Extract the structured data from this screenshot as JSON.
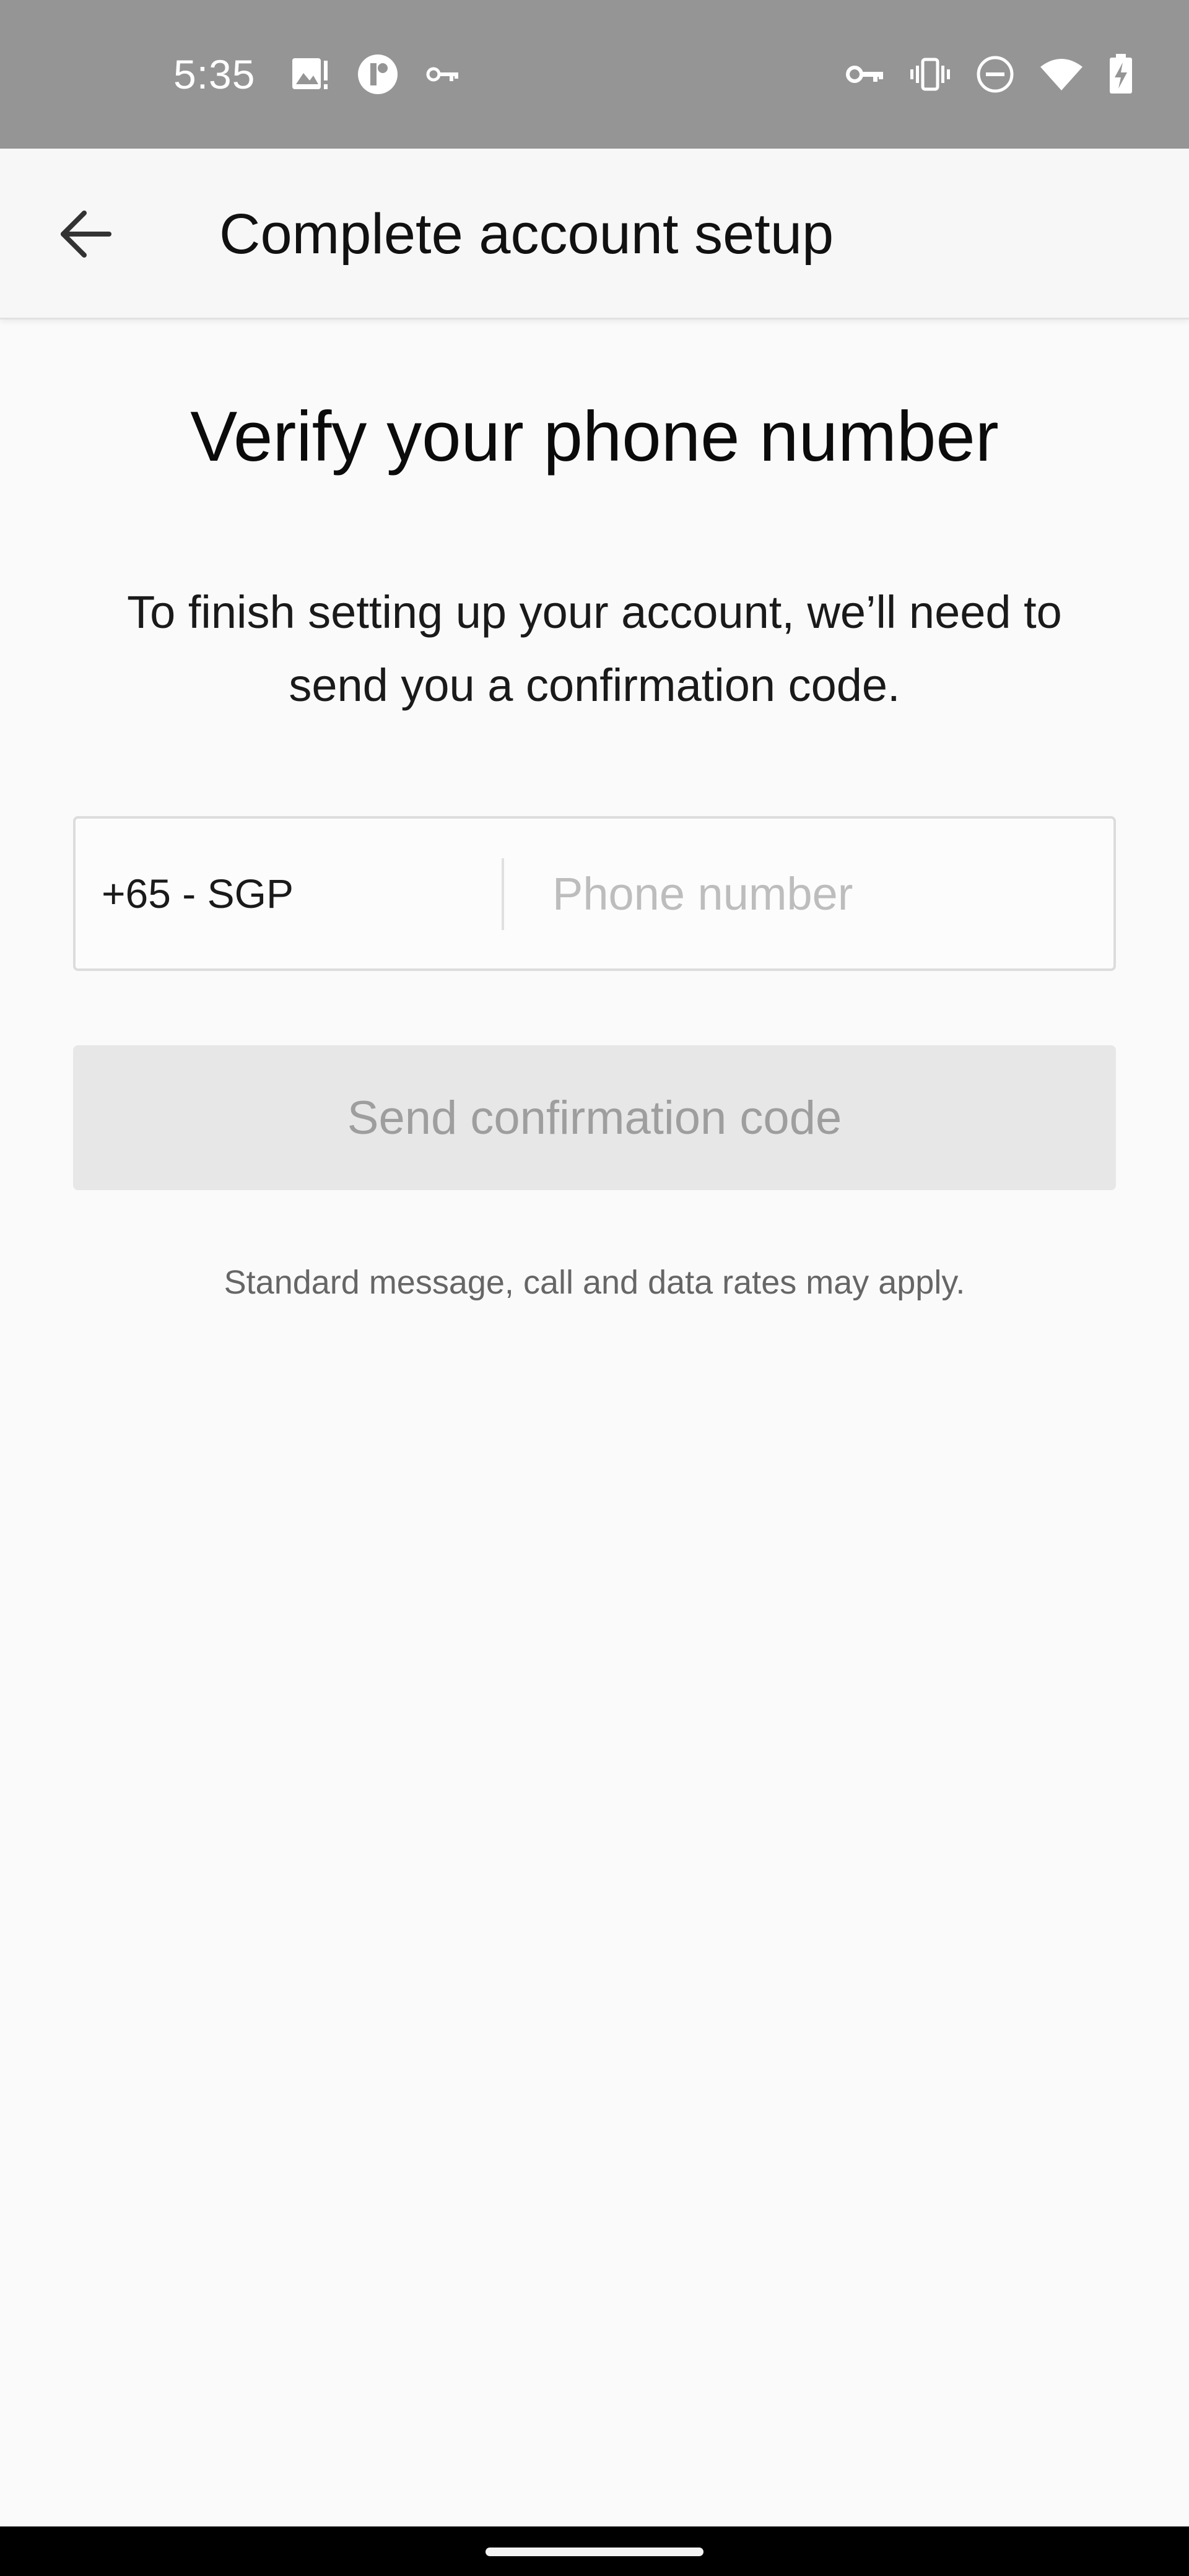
{
  "status_bar": {
    "time": "5:35",
    "left_icons": [
      "image-alert-icon",
      "app-badge-icon",
      "key-icon"
    ],
    "right_icons": [
      "vpn-key-icon",
      "vibrate-icon",
      "do-not-disturb-icon",
      "wifi-icon",
      "battery-charging-icon"
    ]
  },
  "app_bar": {
    "back_icon": "arrow-back-icon",
    "title": "Complete account setup"
  },
  "content": {
    "headline": "Verify your phone number",
    "description": "To finish setting up your account, we’ll need to send you a confirmation code.",
    "country_code": "+65 - SGP",
    "phone_placeholder": "Phone number",
    "phone_value": "",
    "send_button_label": "Send confirmation code",
    "disclaimer": "Standard message, call and data rates may apply."
  },
  "colors": {
    "status_bar_bg": "#959595",
    "background": "#fafafa",
    "button_disabled_bg": "#e7e7e7",
    "button_disabled_text": "#9e9e9e",
    "placeholder": "#bdbdbd"
  }
}
